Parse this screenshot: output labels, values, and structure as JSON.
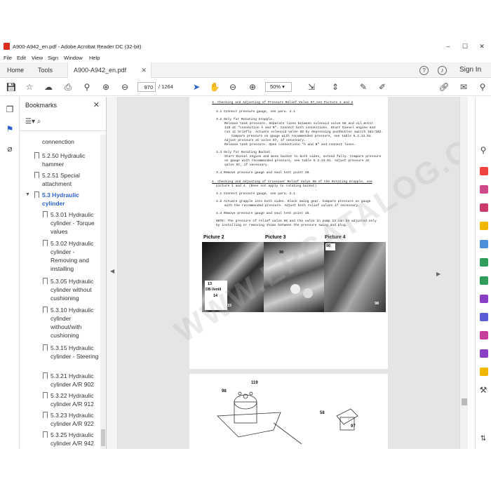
{
  "window": {
    "title": "A900-A942_en.pdf - Adobe Acrobat Reader DC (32-bit)"
  },
  "menu": [
    "File",
    "Edit",
    "View",
    "Sign",
    "Window",
    "Help"
  ],
  "tabs": {
    "home": "Home",
    "tools": "Tools",
    "document": "A900-A942_en.pdf",
    "sign_in": "Sign In"
  },
  "toolbar": {
    "page_current": "970",
    "page_total": "/ 1264",
    "zoom": "50%"
  },
  "bookmarks": {
    "title": "Bookmarks",
    "items": [
      {
        "label": "connenction"
      },
      {
        "label": "5.2.50 Hydraulic hammer"
      },
      {
        "label": "5.2.51 Special attachment"
      },
      {
        "label": "5.3 Hydraulic cylinder"
      },
      {
        "label": "5.3.01 Hydraulic cylinder - Torque values"
      },
      {
        "label": "5.3.02 Hydraulic cylinder - Removing and installing"
      },
      {
        "label": "5.3.05 Hydraulic cylinder without cushioning"
      },
      {
        "label": "5.3.10 Hydraulic cylinder without/with cushioning"
      },
      {
        "label": "5.3.15 Hydraulic cylinder - Steering"
      },
      {
        "label": "5.3.21 Hydraulic cylinder A/R 902"
      },
      {
        "label": "5.3.22 Hydraulic cylinder A/R 912"
      },
      {
        "label": "5.3.23 Hydraulic cylinder A/R 922"
      },
      {
        "label": "5.3.25 Hydraulic cylinder A/R 942"
      }
    ]
  },
  "document": {
    "heading": "3.  Checking and Adjusting of Pressure Relief Valve 97,see Picture 1 and 2",
    "lines": [
      "3.1  Connect pressure gauge, see para. 2.1",
      "3.2  Only for Rotating Grapple.",
      "Release tank pressure. Separate lines between solenoid valve 58 and oil motor",
      "119 at \"connection A and B\". Connect both connections. Start Diesel engine and",
      "run it briefly. Actuate solenoid valve 58 by depressing pushbutton switch 181/182.",
      "Compare pressure on gauge with recommended pressure, see table 5.2.13.01.",
      "Adjust pressure at valve 97, if necessary.",
      "Release tank pressure. Open connections \"A and B\" and connect lines.",
      "3.3  Only for Rotating Bucket.",
      "Start Diesel engine and move bucket to both sides, extend fully. Compare pressure",
      "on gauge with recommended pressure, see table 5.2.13.01. Adjust pressure at",
      "valve 97, if necessary.",
      "3.4  Remove pressure gauge and seal test point 38.",
      "4.  Checking and Adjusting of Crossover Relief Valve 98 of the Rotating Grapple, see",
      "picture 1 and 4. (Does not apply to rotating bucket)",
      "4.1  Connect pressure gauge, see para. 2.1",
      "4.2  Actuate grapple into both sides. Block swing gear. Compare pressure on gauge",
      "with the recommended pressure. Adjust both relief valves if necessary.",
      "4.3  Remove pressure gauge and seal test point 38.",
      "NOTE:  The pressure of relief valve 98 and the valve in pump 13 can be adjusted only",
      "by installing or removing shims between the pressure swing and plug."
    ],
    "pictures": [
      "Picture 2",
      "Picture 3",
      "Picture 4"
    ],
    "callouts": {
      "p2": [
        "13",
        "DB-Ventil",
        "14",
        "15"
      ],
      "p3": [
        "98"
      ],
      "p4": [
        "98",
        "98"
      ],
      "page2": [
        "119",
        "98",
        "58",
        "97"
      ]
    },
    "watermark": "WWW.EPCATALOG.COM"
  },
  "colors": {
    "accent": "#2a5fd1",
    "pdf_red": "#d92d20"
  }
}
